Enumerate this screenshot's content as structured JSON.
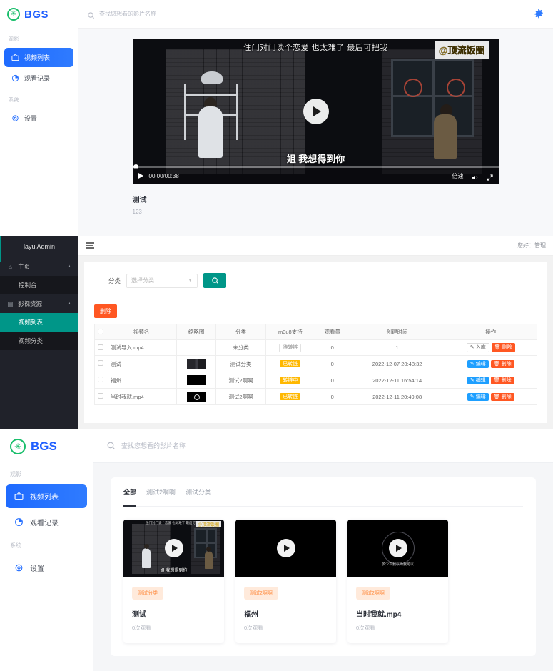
{
  "panel_player": {
    "brand": {
      "logo_glyph": "✳",
      "name": "BGS"
    },
    "sidebar": {
      "groups": [
        {
          "label": "观影",
          "items": [
            {
              "label": "视频列表",
              "icon": "tv-icon",
              "active": true
            },
            {
              "label": "观看记录",
              "icon": "history-pie-icon",
              "active": false
            }
          ]
        },
        {
          "label": "系统",
          "items": [
            {
              "label": "设置",
              "icon": "gear-icon",
              "active": false
            }
          ]
        }
      ]
    },
    "search": {
      "placeholder": "查找您想看的影片名称",
      "icon": "search-icon"
    },
    "settings_icon": "gear-icon",
    "player": {
      "subtitle_top": "住门对门谈个恋爱 也太难了 最后可把我",
      "watermark": "@顶流饭圈",
      "subtitle_bottom": "姐 我想得到你",
      "current_time": "00:00",
      "duration": "00:38",
      "time_display": "00:00/00:38",
      "speed_label": "倍速",
      "volume_icon": "volume-icon",
      "fullscreen_icon": "fullscreen-icon",
      "play_icon": "play-icon"
    },
    "meta": {
      "title": "测试",
      "description": "123"
    }
  },
  "panel_admin": {
    "logo": "layuiAdmin",
    "nav": [
      {
        "label": "主页",
        "icon": "home-icon",
        "expanded": true,
        "children": [
          {
            "label": "控制台",
            "active": false
          }
        ]
      },
      {
        "label": "影视资源",
        "icon": "film-icon",
        "expanded": true,
        "children": [
          {
            "label": "视频列表",
            "active": true
          },
          {
            "label": "视频分类",
            "active": false
          }
        ]
      }
    ],
    "header": {
      "menu_icon": "hamburger-icon",
      "greeting": "您好：管理"
    },
    "filter": {
      "label": "分类",
      "select_value": "选择分类",
      "search_icon": "search-icon"
    },
    "delete_button": "删除",
    "table": {
      "columns": [
        "视频名",
        "缩略图",
        "分类",
        "m3u8支持",
        "观看量",
        "创建时间",
        "操作"
      ],
      "rows": [
        {
          "name": "测试导入.mp4",
          "thumb": "none",
          "category": "未分类",
          "m3u8": "待转链",
          "m3u8_state": "wait",
          "views": "0",
          "created": "1",
          "actions": [
            {
              "label": "入库",
              "icon": "pencil-icon",
              "style": "store"
            },
            {
              "label": "删除",
              "icon": "trash-icon",
              "style": "del"
            }
          ]
        },
        {
          "name": "测试",
          "thumb": "scene",
          "category": "测试分类",
          "m3u8": "已转链",
          "m3u8_state": "done",
          "views": "0",
          "created": "2022-12-07 20:48:32",
          "actions": [
            {
              "label": "编辑",
              "icon": "pencil-icon",
              "style": "edit"
            },
            {
              "label": "删除",
              "icon": "trash-icon",
              "style": "del"
            }
          ]
        },
        {
          "name": "福州",
          "thumb": "black",
          "category": "测试2啊啊",
          "m3u8": "转链中",
          "m3u8_state": "doing",
          "views": "0",
          "created": "2022-12-11 16:54:14",
          "actions": [
            {
              "label": "编辑",
              "icon": "pencil-icon",
              "style": "edit"
            },
            {
              "label": "删除",
              "icon": "trash-icon",
              "style": "del"
            }
          ]
        },
        {
          "name": "当时我就.mp4",
          "thumb": "ring",
          "category": "测试2啊啊",
          "m3u8": "已转链",
          "m3u8_state": "done",
          "views": "0",
          "created": "2022-12-11 20:49:08",
          "actions": [
            {
              "label": "编辑",
              "icon": "pencil-icon",
              "style": "edit"
            },
            {
              "label": "删除",
              "icon": "trash-icon",
              "style": "del"
            }
          ]
        }
      ]
    }
  },
  "panel_grid": {
    "brand": {
      "logo_glyph": "✳",
      "name": "BGS"
    },
    "sidebar": {
      "groups": [
        {
          "label": "观影",
          "items": [
            {
              "label": "视频列表",
              "icon": "tv-icon",
              "active": true
            },
            {
              "label": "观看记录",
              "icon": "history-pie-icon",
              "active": false
            }
          ]
        },
        {
          "label": "系统",
          "items": [
            {
              "label": "设置",
              "icon": "gear-icon",
              "active": false
            }
          ]
        }
      ]
    },
    "search": {
      "placeholder": "查找您想看的影片名称",
      "icon": "search-icon"
    },
    "tabs": [
      {
        "label": "全部",
        "active": true
      },
      {
        "label": "测试2啊啊",
        "active": false
      },
      {
        "label": "测试分类",
        "active": false
      }
    ],
    "cards": [
      {
        "tag": "测试分类",
        "title": "测试",
        "views": "0次观看",
        "thumb_kind": "scene",
        "subtitle": "姐 我想得到你",
        "top_subtitle": "住门对门谈个恋爱 也太难了 最后可把我",
        "watermark": "@顶流饭圈"
      },
      {
        "tag": "测试2啊啊",
        "title": "福州",
        "views": "0次观看",
        "thumb_kind": "black",
        "subtitle": "",
        "top_subtitle": "",
        "watermark": ""
      },
      {
        "tag": "测试2啊啊",
        "title": "当时我就.mp4",
        "views": "0次观看",
        "thumb_kind": "ring",
        "subtitle": "多少次我以为我可以",
        "top_subtitle": "",
        "watermark": ""
      }
    ]
  },
  "colors": {
    "accent_blue": "#1f6bff",
    "brand_green": "#19be6b",
    "admin_teal": "#009688",
    "admin_orange": "#ff5722",
    "badge_yellow": "#ffb800",
    "tag_orange": "#ff8a3d",
    "edit_blue": "#1e9fff"
  }
}
